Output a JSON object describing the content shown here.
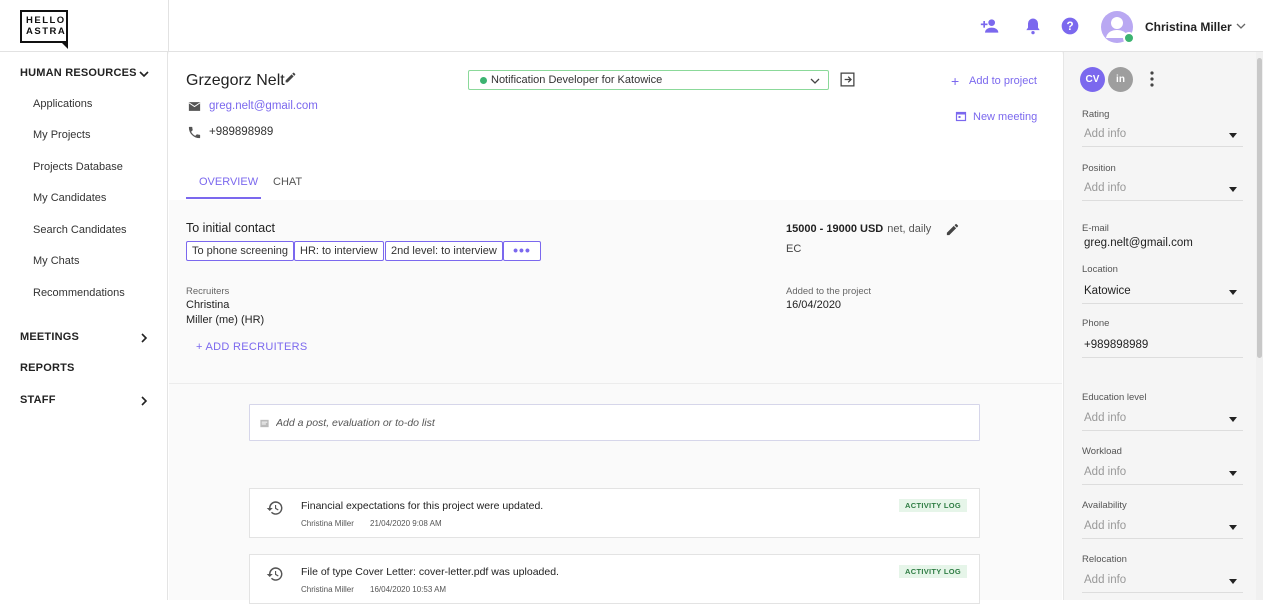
{
  "brand": {
    "logo_line1": "HELLO",
    "logo_line2": "ASTRA"
  },
  "user": {
    "name": "Christina Miller"
  },
  "sidebar": {
    "sections": [
      {
        "label": "HUMAN RESOURCES"
      },
      {
        "label": "MEETINGS"
      },
      {
        "label": "REPORTS"
      },
      {
        "label": "STAFF"
      }
    ],
    "items": [
      {
        "label": "Applications"
      },
      {
        "label": "My Projects"
      },
      {
        "label": "Projects Database"
      },
      {
        "label": "My Candidates"
      },
      {
        "label": "Search Candidates"
      },
      {
        "label": "My Chats"
      },
      {
        "label": "Recommendations"
      }
    ]
  },
  "candidate": {
    "name": "Grzegorz Nelt",
    "email": "greg.nelt@gmail.com",
    "phone": "+989898989"
  },
  "position_select": {
    "value": "Notification Developer for Katowice"
  },
  "actions": {
    "add_to_project": "Add to project",
    "new_meeting": "New meeting"
  },
  "tabs": [
    {
      "label": "OVERVIEW"
    },
    {
      "label": "CHAT"
    }
  ],
  "overview": {
    "stage": "To initial contact",
    "next_steps": [
      "To phone screening",
      "HR: to interview",
      "2nd level: to interview"
    ],
    "more_label": "•••",
    "recruiters_label": "Recruiters",
    "recruiter_line1": "Christina",
    "recruiter_line2": "Miller (me) (HR)",
    "add_recruiters": "+ ADD RECRUITERS",
    "salary": "15000 - 19000 USD",
    "salary_terms": "net, daily",
    "contract": "EC",
    "added_label": "Added to the project",
    "added_date": "16/04/2020"
  },
  "post": {
    "placeholder": "Add a post, evaluation or to-do list"
  },
  "activity": [
    {
      "message": "Financial expectations for this project were updated.",
      "author": "Christina Miller",
      "date": "21/04/2020 9:08 AM",
      "badge": "ACTIVITY LOG"
    },
    {
      "message": "File of type Cover Letter: cover-letter.pdf was uploaded.",
      "author": "Christina Miller",
      "date": "16/04/2020 10:53 AM",
      "badge": "ACTIVITY LOG"
    }
  ],
  "right_panel": {
    "cv_label": "CV",
    "in_label": "in",
    "fields": {
      "rating": {
        "label": "Rating",
        "value": "Add info"
      },
      "position": {
        "label": "Position",
        "value": "Add info"
      },
      "email": {
        "label": "E-mail",
        "value": "greg.nelt@gmail.com"
      },
      "location": {
        "label": "Location",
        "value": "Katowice"
      },
      "phone": {
        "label": "Phone",
        "value": "+989898989"
      },
      "education": {
        "label": "Education level",
        "value": "Add info"
      },
      "workload": {
        "label": "Workload",
        "value": "Add info"
      },
      "availability": {
        "label": "Availability",
        "value": "Add info"
      },
      "relocation": {
        "label": "Relocation",
        "value": "Add info"
      }
    }
  },
  "colors": {
    "accent": "#7b68ee",
    "success": "#3cb371",
    "badge_bg": "#e6f5e9"
  }
}
